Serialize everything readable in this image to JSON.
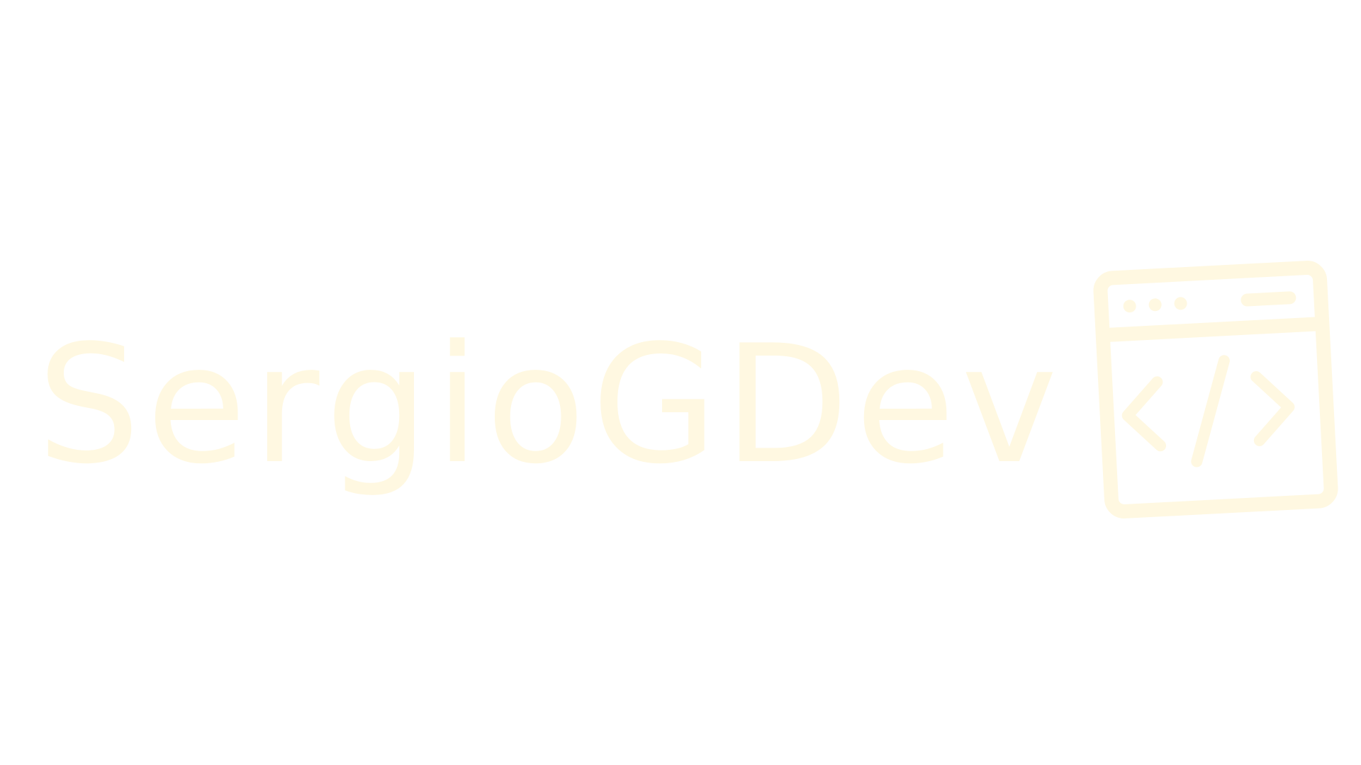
{
  "logo": {
    "text": "SergioGDev",
    "letters": [
      "S",
      "e",
      "r",
      "g",
      "i",
      "o",
      "G",
      "D",
      "e",
      "v"
    ],
    "color": "#fff8e1",
    "icon": "code-window-icon"
  }
}
